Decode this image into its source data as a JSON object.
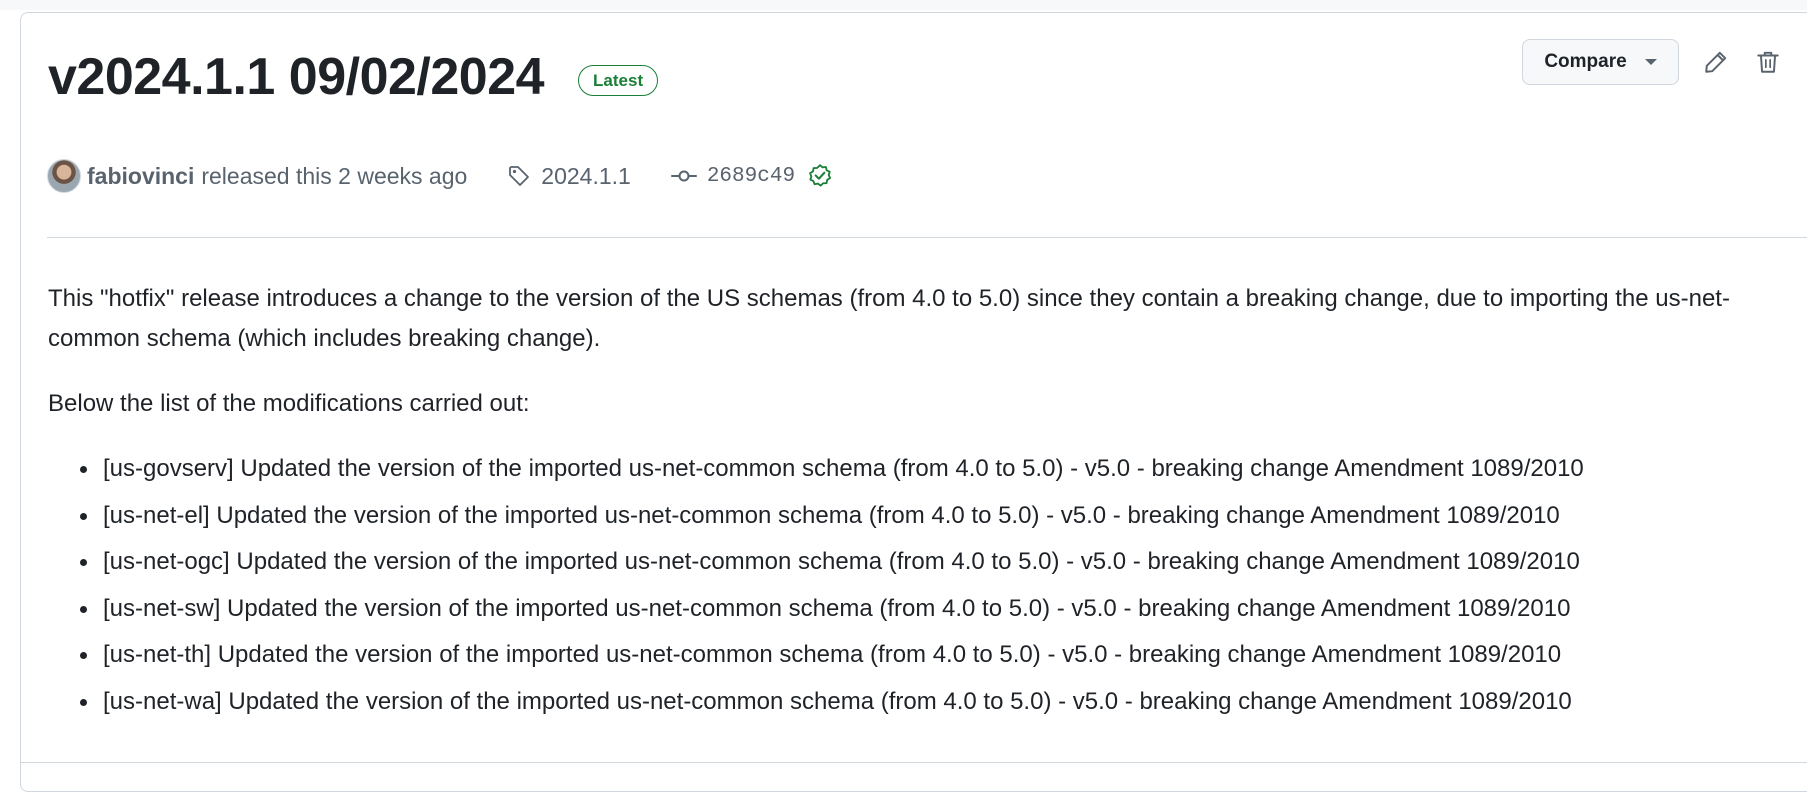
{
  "release": {
    "title": "v2024.1.1 09/02/2024",
    "badge": "Latest",
    "author": "fabiovinci",
    "released_text": "released this 2 weeks ago",
    "tag": "2024.1.1",
    "commit": "2689c49"
  },
  "actions": {
    "compare_label": "Compare"
  },
  "body": {
    "intro": "This \"hotfix\" release introduces a change to the version of the US schemas (from 4.0 to 5.0) since they contain a breaking change, due to importing the us-net-common schema (which includes breaking change).",
    "lead": "Below the list of the modifications carried out:",
    "items": [
      "[us-govserv] Updated the version of the imported us-net-common schema (from 4.0 to 5.0) - v5.0 - breaking change Amendment 1089/2010",
      "[us-net-el] Updated the version of the imported us-net-common schema (from 4.0 to 5.0) - v5.0 - breaking change Amendment 1089/2010",
      "[us-net-ogc] Updated the version of the imported us-net-common schema (from 4.0 to 5.0) - v5.0 - breaking change Amendment 1089/2010",
      "[us-net-sw] Updated the version of the imported us-net-common schema (from 4.0 to 5.0) - v5.0 - breaking change Amendment 1089/2010",
      "[us-net-th] Updated the version of the imported us-net-common schema (from 4.0 to 5.0) - v5.0 - breaking change Amendment 1089/2010",
      "[us-net-wa] Updated the version of the imported us-net-common schema (from 4.0 to 5.0) - v5.0 - breaking change Amendment 1089/2010"
    ]
  },
  "icons": {
    "edit": "pencil-icon",
    "delete": "trash-icon",
    "tag": "tag-icon",
    "commit": "git-commit-icon",
    "verified": "verified-check-icon"
  },
  "colors": {
    "accent_green": "#1a7f37",
    "muted_text": "#59636e",
    "border": "#d0d7de"
  }
}
